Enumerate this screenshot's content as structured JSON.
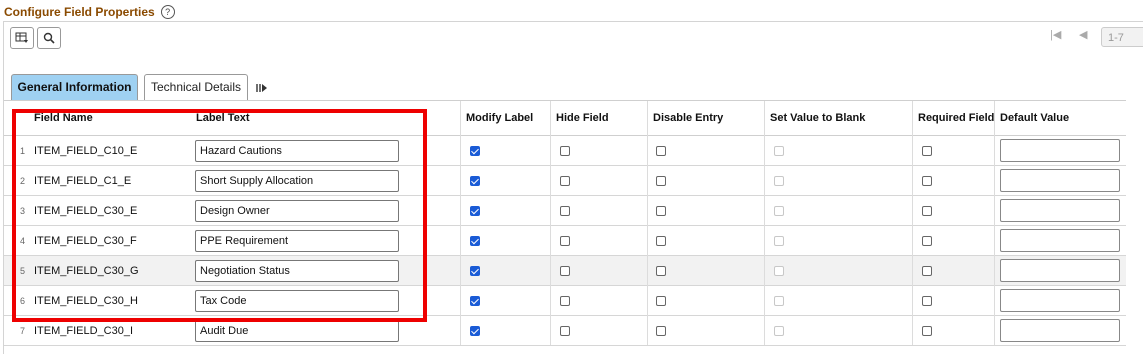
{
  "header": {
    "title": "Configure Field Properties",
    "help_icon": "?"
  },
  "toolbar": {
    "personalize_icon": "grid-settings-icon",
    "find_icon": "search-icon",
    "first_icon": "|◀",
    "prev_icon": "◀",
    "pager_text": "1-7"
  },
  "tabs": [
    {
      "label": "General Information",
      "active": true
    },
    {
      "label": "Technical Details",
      "active": false
    }
  ],
  "tab_more_icon": "show-all-columns-icon",
  "columns": {
    "field_name": "Field Name",
    "label_text": "Label Text",
    "modify_label": "Modify Label",
    "hide_field": "Hide Field",
    "disable_entry": "Disable Entry",
    "set_value_blank": "Set Value to Blank",
    "required_field": "Required Field",
    "default_value": "Default Value"
  },
  "rows": [
    {
      "num": "1",
      "field_name": "ITEM_FIELD_C10_E",
      "label_text": "Hazard Cautions",
      "modify_label": true,
      "hide_field": false,
      "disable_entry": false,
      "set_value_blank": false,
      "required_field": false,
      "default_value": ""
    },
    {
      "num": "2",
      "field_name": "ITEM_FIELD_C1_E",
      "label_text": "Short Supply Allocation",
      "modify_label": true,
      "hide_field": false,
      "disable_entry": false,
      "set_value_blank": false,
      "required_field": false,
      "default_value": ""
    },
    {
      "num": "3",
      "field_name": "ITEM_FIELD_C30_E",
      "label_text": "Design Owner",
      "modify_label": true,
      "hide_field": false,
      "disable_entry": false,
      "set_value_blank": false,
      "required_field": false,
      "default_value": ""
    },
    {
      "num": "4",
      "field_name": "ITEM_FIELD_C30_F",
      "label_text": "PPE Requirement",
      "modify_label": true,
      "hide_field": false,
      "disable_entry": false,
      "set_value_blank": false,
      "required_field": false,
      "default_value": ""
    },
    {
      "num": "5",
      "field_name": "ITEM_FIELD_C30_G",
      "label_text": "Negotiation Status",
      "modify_label": true,
      "hide_field": false,
      "disable_entry": false,
      "set_value_blank": false,
      "required_field": false,
      "default_value": ""
    },
    {
      "num": "6",
      "field_name": "ITEM_FIELD_C30_H",
      "label_text": "Tax Code",
      "modify_label": true,
      "hide_field": false,
      "disable_entry": false,
      "set_value_blank": false,
      "required_field": false,
      "default_value": ""
    },
    {
      "num": "7",
      "field_name": "ITEM_FIELD_C30_I",
      "label_text": "Audit Due",
      "modify_label": true,
      "hide_field": false,
      "disable_entry": false,
      "set_value_blank": false,
      "required_field": false,
      "default_value": ""
    }
  ],
  "colors": {
    "title": "#8a4a00",
    "active_tab": "#9fd1f2",
    "checkbox_checked": "#1a5bd6",
    "highlight": "#ee0000"
  }
}
